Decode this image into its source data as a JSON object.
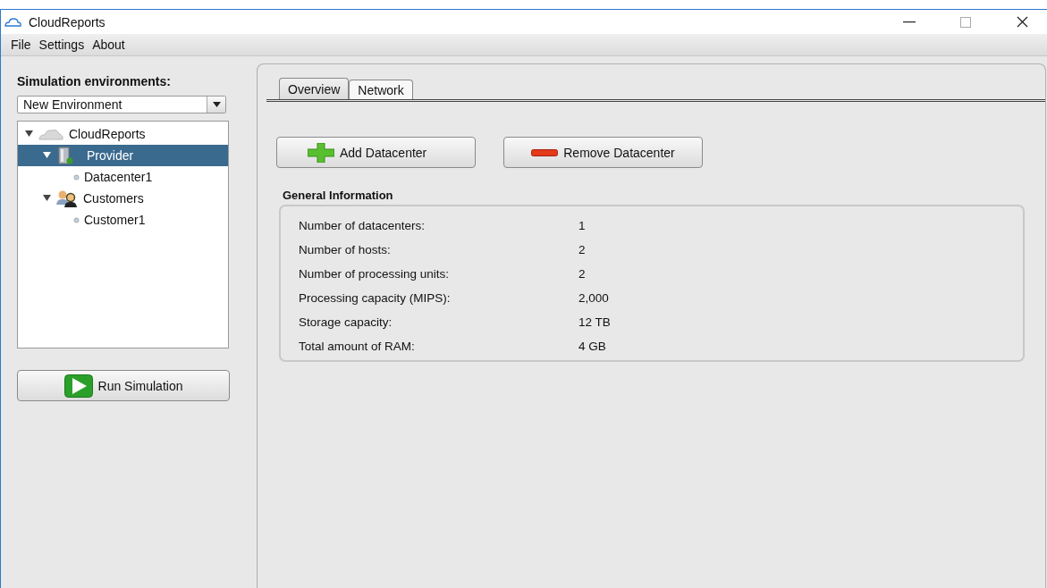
{
  "window": {
    "title": "CloudReports"
  },
  "menu": [
    "File",
    "Settings",
    "About"
  ],
  "sidebar": {
    "label": "Simulation environments:",
    "environment": {
      "value": "New Environment"
    },
    "tree": [
      {
        "label": "CloudReports",
        "kind": "cloud",
        "expanded": true,
        "selected": false,
        "children": [
          {
            "label": "Provider",
            "kind": "server",
            "expanded": true,
            "selected": true,
            "children": [
              {
                "label": "Datacenter1",
                "kind": "leaf",
                "selected": false
              }
            ]
          },
          {
            "label": "Customers",
            "kind": "people",
            "expanded": true,
            "selected": false,
            "children": [
              {
                "label": "Customer1",
                "kind": "leaf",
                "selected": false
              }
            ]
          }
        ]
      }
    ],
    "run_button": "Run Simulation"
  },
  "tabs": [
    {
      "label": "Overview",
      "selected": true
    },
    {
      "label": "Network",
      "selected": false
    }
  ],
  "actions": [
    {
      "label": "Add Datacenter",
      "kind": "add"
    },
    {
      "label": "Remove Datacenter",
      "kind": "remove"
    }
  ],
  "general_information": {
    "title": "General Information",
    "rows": [
      {
        "label": "Number of datacenters:",
        "value": "1"
      },
      {
        "label": "Number of hosts:",
        "value": "2"
      },
      {
        "label": "Number of processing units:",
        "value": "2"
      },
      {
        "label": "Processing capacity (MIPS):",
        "value": "2,000"
      },
      {
        "label": "Storage capacity:",
        "value": "12 TB"
      },
      {
        "label": "Total amount of RAM:",
        "value": "4 GB"
      }
    ]
  }
}
